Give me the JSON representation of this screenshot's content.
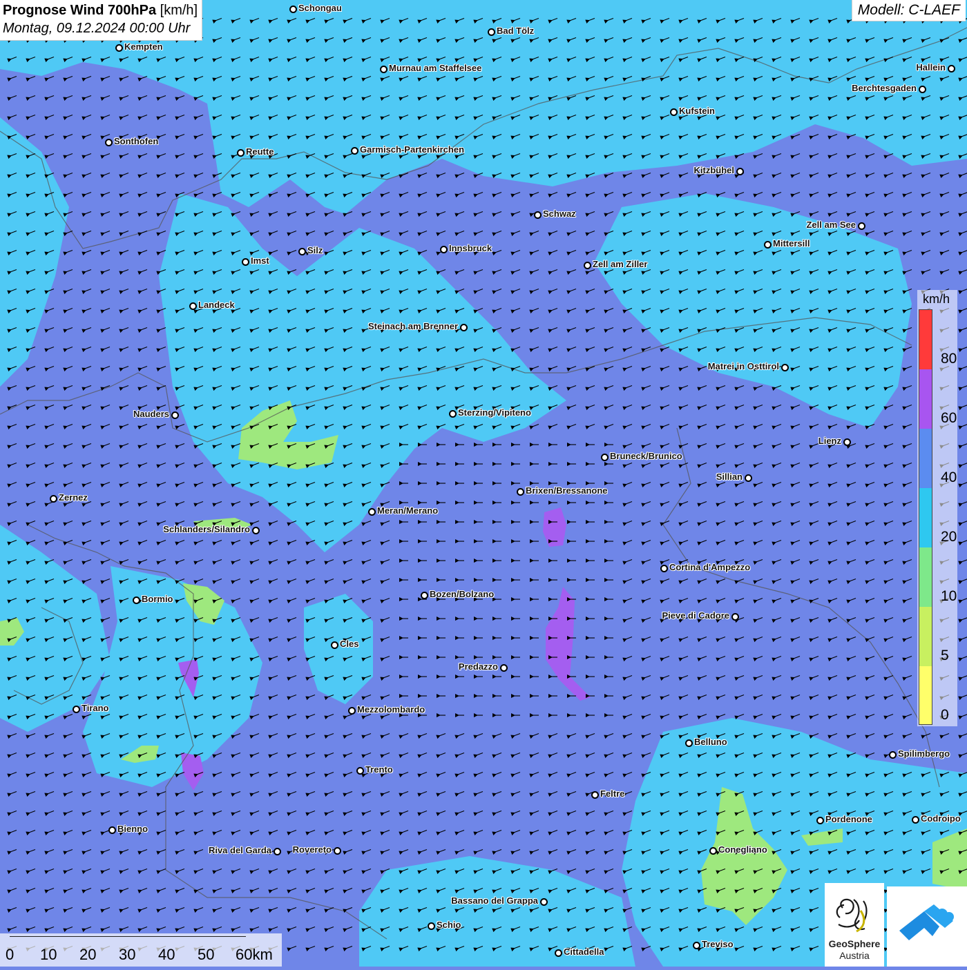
{
  "header": {
    "title_bold": "Prognose Wind 700hPa",
    "title_unit": " [km/h]",
    "datetime": "Montag, 09.12.2024 00:00 Uhr"
  },
  "model": {
    "label": "Modell: C-LAEF"
  },
  "legend": {
    "unit": "km/h",
    "ticks": [
      "80",
      "60",
      "40",
      "20",
      "10",
      "5",
      "0"
    ],
    "colors": [
      "#ff3a3a",
      "#a855f0",
      "#5b8cf0",
      "#2ec8f0",
      "#7ee88a",
      "#c8f060",
      "#ffff6a"
    ]
  },
  "scalebar": {
    "labels": [
      "0",
      "10",
      "20",
      "30",
      "40",
      "50",
      "60km"
    ]
  },
  "logos": {
    "geosphere_line1": "GeoSphere",
    "geosphere_line2": "Austria"
  },
  "colors": {
    "wind_20_40": "#4fc9f5",
    "wind_40_60": "#6a83e6",
    "wind_10_20": "#9ee87e",
    "wind_60_80": "#a45ef0"
  },
  "cities": [
    {
      "name": "Schongau"
    },
    {
      "name": "Bad Tölz"
    },
    {
      "name": "Kempten"
    },
    {
      "name": "Murnau am Staffelsee"
    },
    {
      "name": "Hallein"
    },
    {
      "name": "Berchtesgaden"
    },
    {
      "name": "Kufstein"
    },
    {
      "name": "Sonthofen"
    },
    {
      "name": "Reutte"
    },
    {
      "name": "Garmisch-Partenkirchen"
    },
    {
      "name": "Kitzbühel"
    },
    {
      "name": "Schwaz"
    },
    {
      "name": "Zell am See"
    },
    {
      "name": "Mittersill"
    },
    {
      "name": "Innsbruck"
    },
    {
      "name": "Silz"
    },
    {
      "name": "Imst"
    },
    {
      "name": "Zell am Ziller"
    },
    {
      "name": "Landeck"
    },
    {
      "name": "Steinach am Brenner"
    },
    {
      "name": "Matrei in Osttirol"
    },
    {
      "name": "Nauders"
    },
    {
      "name": "Sterzing/Vipiteno"
    },
    {
      "name": "Lienz"
    },
    {
      "name": "Bruneck/Brunico"
    },
    {
      "name": "Sillian"
    },
    {
      "name": "Zernez"
    },
    {
      "name": "Brixen/Bressanone"
    },
    {
      "name": "Meran/Merano"
    },
    {
      "name": "Schlanders/Silandro"
    },
    {
      "name": "Cortina d'Ampezzo"
    },
    {
      "name": "Bormio"
    },
    {
      "name": "Bozen/Bolzano"
    },
    {
      "name": "Pieve di Cadore"
    },
    {
      "name": "Cles"
    },
    {
      "name": "Predazzo"
    },
    {
      "name": "Tirano"
    },
    {
      "name": "Mezzolombardo"
    },
    {
      "name": "Belluno"
    },
    {
      "name": "Spilimbergo"
    },
    {
      "name": "Trento"
    },
    {
      "name": "Feltre"
    },
    {
      "name": "Pordenone"
    },
    {
      "name": "Codroipo"
    },
    {
      "name": "Bienno"
    },
    {
      "name": "Riva del Garda"
    },
    {
      "name": "Rovereto"
    },
    {
      "name": "Conegliano"
    },
    {
      "name": "Bassano del Grappa"
    },
    {
      "name": "Schio"
    },
    {
      "name": "Treviso"
    },
    {
      "name": "Cittadella"
    }
  ]
}
